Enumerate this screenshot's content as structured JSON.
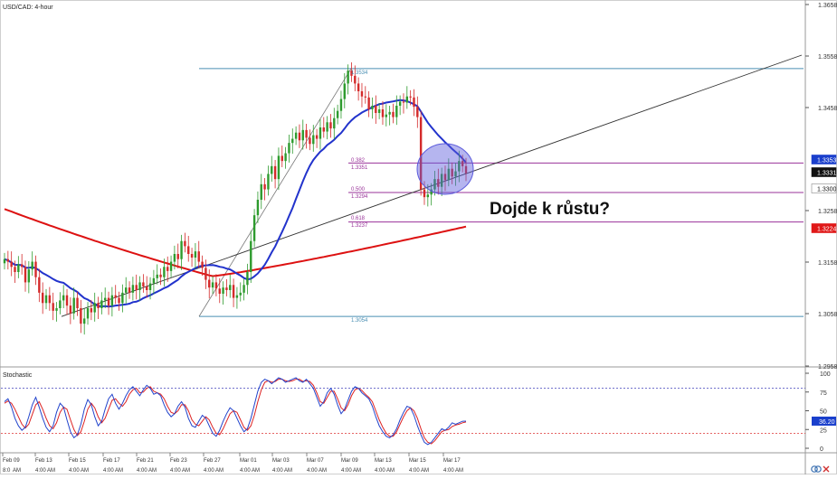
{
  "window": {
    "pair_label": "USD/CAD: 4-hour",
    "annotation": "Dojde k růstu?"
  },
  "colors": {
    "candle_up": "#2e9b2e",
    "candle_down": "#d42a2a",
    "ma_fast": "#2233cc",
    "ma_slow": "#dd1111",
    "fib_line": "#993399",
    "swing_line": "#4a8fb3",
    "trendline": "#333333",
    "highlight": "#5b5bdc",
    "stoch_k": "#2244cc",
    "stoch_d": "#dd2222",
    "level_80": "#4444bb",
    "level_20": "#dd3333"
  },
  "x_axis": {
    "dates": [
      "Feb 09",
      "Feb 13",
      "Feb 15",
      "Feb 17",
      "Feb 21",
      "Feb 23",
      "Feb 27",
      "Mar 01",
      "Mar 03",
      "Mar 07",
      "Mar 09",
      "Mar 13",
      "Mar 15",
      "Mar 17"
    ],
    "time_labels": [
      "8:0",
      "4:00 AM",
      "4:00 AM",
      "4:00 AM",
      "4:00 AM",
      "4:00 AM",
      "4:00 AM",
      "4:00 AM",
      "4:00 AM",
      "4:00 AM",
      "4:00 AM",
      "4:00 AM",
      "4:00 AM",
      "4:00 AM"
    ],
    "edge_label": "AM"
  },
  "price_axis": {
    "ticks": [
      "1.3658",
      "1.3558",
      "1.3458",
      "1.3353",
      "1.3331",
      "1.3300",
      "1.3258",
      "1.3224",
      "1.3158",
      "1.3058",
      "1.2958"
    ],
    "badges": [
      {
        "text": "1.3353",
        "kind": "blue"
      },
      {
        "text": "1.3331",
        "kind": "black"
      },
      {
        "text": "1.3300",
        "kind": "white"
      },
      {
        "text": "1.3224",
        "kind": "red"
      }
    ]
  },
  "stoch_axis": {
    "ticks": [
      "100",
      "75",
      "50",
      "25",
      "0"
    ],
    "badge": "36.20",
    "label": "Stochastic"
  },
  "fib_labels": {
    "r382": "0.382",
    "p382": "1.3351",
    "r500": "0.500",
    "p500": "1.3294",
    "r618": "0.618",
    "p618": "1.3237",
    "high": "1.3534",
    "low": "1.3054"
  },
  "chart_data": [
    {
      "type": "candlestick",
      "title": "USD/CAD: 4-hour",
      "ylim": [
        1.295,
        1.366
      ],
      "price_ticks": [
        1.2958,
        1.3058,
        1.3158,
        1.3258,
        1.3358,
        1.3458,
        1.3558,
        1.3658
      ],
      "close": [
        1.3165,
        1.316,
        1.315,
        1.314,
        1.3155,
        1.315,
        1.312,
        1.3145,
        1.316,
        1.313,
        1.31,
        1.308,
        1.3095,
        1.308,
        1.3065,
        1.307,
        1.3085,
        1.3095,
        1.3075,
        1.306,
        1.309,
        1.307,
        1.304,
        1.305,
        1.307,
        1.3062,
        1.308,
        1.307,
        1.3085,
        1.309,
        1.3075,
        1.3095,
        1.309,
        1.308,
        1.31,
        1.311,
        1.31,
        1.3115,
        1.3105,
        1.312,
        1.3112,
        1.3105,
        1.3118,
        1.3128,
        1.3135,
        1.313,
        1.315,
        1.3142,
        1.316,
        1.3175,
        1.3165,
        1.32,
        1.319,
        1.3175,
        1.3168,
        1.318,
        1.316,
        1.3148,
        1.3125,
        1.311,
        1.312,
        1.3108,
        1.3098,
        1.311,
        1.3105,
        1.3115,
        1.309,
        1.3095,
        1.31,
        1.3115,
        1.314,
        1.32,
        1.325,
        1.328,
        1.331,
        1.33,
        1.333,
        1.3345,
        1.332,
        1.3365,
        1.3355,
        1.337,
        1.339,
        1.3398,
        1.341,
        1.3395,
        1.3415,
        1.34,
        1.3388,
        1.3405,
        1.3398,
        1.342,
        1.3412,
        1.343,
        1.3418,
        1.3438,
        1.3452,
        1.3475,
        1.3505,
        1.353,
        1.352,
        1.3505,
        1.349,
        1.348,
        1.3478,
        1.3455,
        1.3462,
        1.3448,
        1.3455,
        1.344,
        1.3445,
        1.345,
        1.344,
        1.3462,
        1.347,
        1.3468,
        1.348,
        1.3478,
        1.346,
        1.344,
        1.33,
        1.3285,
        1.329,
        1.33,
        1.332,
        1.3305,
        1.333,
        1.3318,
        1.334,
        1.3325,
        1.3335,
        1.3355,
        1.3345,
        1.3331
      ],
      "range_high": 1.3534,
      "range_low": 1.3054,
      "fib_levels": [
        {
          "ratio": 0.382,
          "price": 1.3351
        },
        {
          "ratio": 0.5,
          "price": 1.3294
        },
        {
          "ratio": 0.618,
          "price": 1.3237
        }
      ],
      "moving_averages": [
        {
          "color": "blue",
          "from": 1.318,
          "to": 1.3345
        },
        {
          "color": "red",
          "from": 1.326,
          "to": 1.3228
        }
      ],
      "current_price": 1.3331,
      "grid": false
    },
    {
      "type": "line",
      "title": "Stochastic",
      "ylim": [
        0,
        100
      ],
      "levels": [
        80,
        20
      ],
      "last_value": 36.2,
      "k": [
        62,
        66,
        55,
        40,
        30,
        24,
        28,
        42,
        58,
        68,
        55,
        40,
        28,
        22,
        30,
        48,
        60,
        55,
        38,
        22,
        14,
        18,
        32,
        52,
        65,
        58,
        42,
        30,
        36,
        52,
        66,
        72,
        60,
        52,
        60,
        70,
        78,
        82,
        76,
        70,
        78,
        84,
        80,
        72,
        74,
        70,
        58,
        48,
        42,
        46,
        56,
        62,
        55,
        40,
        30,
        28,
        36,
        44,
        40,
        30,
        20,
        16,
        24,
        36,
        46,
        54,
        50,
        40,
        30,
        22,
        26,
        40,
        58,
        76,
        88,
        92,
        90,
        86,
        90,
        94,
        92,
        88,
        90,
        92,
        94,
        90,
        88,
        92,
        86,
        80,
        68,
        56,
        62,
        74,
        80,
        72,
        58,
        46,
        52,
        64,
        76,
        82,
        80,
        74,
        70,
        66,
        56,
        42,
        30,
        22,
        16,
        14,
        18,
        26,
        38,
        48,
        56,
        54,
        44,
        30,
        18,
        8,
        5,
        8,
        14,
        20,
        26,
        24,
        28,
        34,
        32,
        34,
        36,
        36.2
      ],
      "d": [
        60,
        63,
        60,
        52,
        42,
        32,
        27,
        32,
        45,
        58,
        62,
        52,
        40,
        30,
        26,
        34,
        48,
        55,
        52,
        38,
        25,
        17,
        22,
        36,
        52,
        60,
        54,
        42,
        34,
        40,
        52,
        64,
        66,
        60,
        56,
        62,
        72,
        78,
        80,
        74,
        75,
        80,
        82,
        76,
        74,
        72,
        66,
        56,
        48,
        46,
        50,
        58,
        58,
        50,
        38,
        32,
        30,
        36,
        42,
        38,
        28,
        20,
        18,
        26,
        36,
        46,
        50,
        48,
        38,
        28,
        24,
        30,
        44,
        62,
        78,
        88,
        90,
        88,
        89,
        92,
        92,
        90,
        89,
        90,
        92,
        92,
        89,
        90,
        89,
        84,
        74,
        62,
        60,
        68,
        76,
        76,
        66,
        54,
        50,
        58,
        70,
        78,
        80,
        77,
        72,
        68,
        62,
        50,
        38,
        28,
        20,
        16,
        16,
        22,
        32,
        42,
        50,
        54,
        50,
        40,
        26,
        14,
        8,
        6,
        10,
        16,
        22,
        24,
        25,
        29,
        31,
        32,
        34,
        35
      ]
    }
  ]
}
